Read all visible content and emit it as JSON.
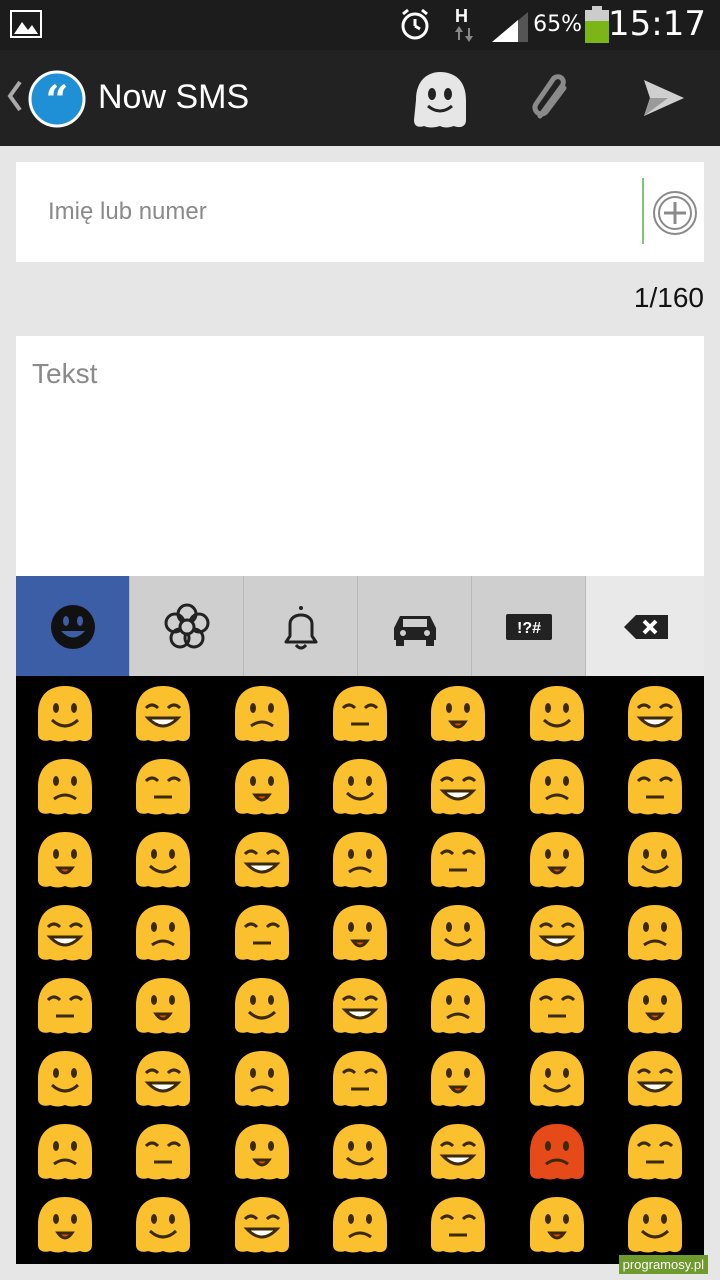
{
  "status_bar": {
    "time": "15:17",
    "battery": "65%",
    "network_label": "H"
  },
  "action_bar": {
    "title": "Now SMS"
  },
  "recipient": {
    "placeholder": "Imię lub numer"
  },
  "counter": "1/160",
  "message": {
    "placeholder": "Tekst"
  },
  "emoji_tabs": [
    {
      "icon": "smiley-icon",
      "active": true
    },
    {
      "icon": "flower-icon",
      "active": false
    },
    {
      "icon": "bell-icon",
      "active": false
    },
    {
      "icon": "car-icon",
      "active": false
    },
    {
      "icon": "symbols-icon",
      "label": "!?#",
      "active": false
    },
    {
      "icon": "backspace-icon",
      "active": false
    }
  ],
  "watermark": "programosy.pl",
  "colors": {
    "accent": "#3b5ea6",
    "emoji_yellow": "#fbc02d",
    "panel_black": "#000000"
  }
}
